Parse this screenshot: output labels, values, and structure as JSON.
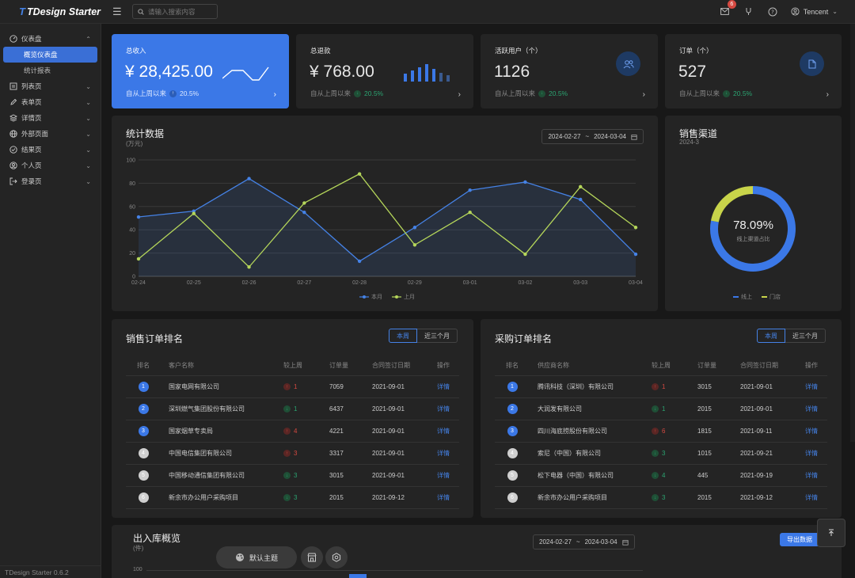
{
  "app": {
    "logo_mark": "T",
    "logo_text": "TDesign Starter",
    "version": "TDesign Starter 0.6.2"
  },
  "header": {
    "search_placeholder": "请输入搜索内容",
    "notice_count": "6",
    "user_name": "Tencent"
  },
  "sidebar": {
    "items": [
      {
        "label": "仪表盘",
        "icon": "dashboard-icon"
      },
      {
        "label": "列表页",
        "icon": "list-icon"
      },
      {
        "label": "表单页",
        "icon": "edit-icon"
      },
      {
        "label": "详情页",
        "icon": "layers-icon"
      },
      {
        "label": "外部页面",
        "icon": "globe-icon"
      },
      {
        "label": "结果页",
        "icon": "check-circle-icon"
      },
      {
        "label": "个人页",
        "icon": "user-circle-icon"
      },
      {
        "label": "登录页",
        "icon": "logout-icon"
      }
    ],
    "sub_items": [
      {
        "label": "概览仪表盘",
        "active": true
      },
      {
        "label": "统计报表",
        "active": false
      }
    ]
  },
  "stats": [
    {
      "title": "总收入",
      "value": "¥ 28,425.00",
      "foot": "自从上周以来",
      "delta": "20.5%",
      "trend": "down"
    },
    {
      "title": "总退款",
      "value": "¥ 768.00",
      "foot": "自从上周以来",
      "delta": "20.5%",
      "trend": "down"
    },
    {
      "title": "活跃用户（个）",
      "value": "1126",
      "foot": "自从上周以来",
      "delta": "20.5%",
      "trend": "down",
      "icon": "users-icon"
    },
    {
      "title": "订单（个）",
      "value": "527",
      "foot": "自从上周以来",
      "delta": "20.5%",
      "trend": "down",
      "icon": "file-icon"
    }
  ],
  "stats_chart": {
    "title": "统计数据",
    "subtitle": "(万元)",
    "date_start": "2024-02-27",
    "date_sep": "~",
    "date_end": "2024-03-04"
  },
  "chart_data": [
    {
      "type": "line",
      "title": "统计数据",
      "ylabel": "(万元)",
      "categories": [
        "02-24",
        "02-25",
        "02-26",
        "02-27",
        "02-28",
        "02-29",
        "03-01",
        "03-02",
        "03-03",
        "03-04"
      ],
      "ylim": [
        0,
        100
      ],
      "yticks": [
        0,
        20,
        40,
        60,
        80,
        100
      ],
      "grid": true,
      "legend": "bottom-center",
      "series": [
        {
          "name": "本月",
          "color": "#4582e6",
          "area": true,
          "values": [
            51,
            56,
            84,
            55,
            13,
            42,
            74,
            81,
            66,
            19
          ]
        },
        {
          "name": "上月",
          "color": "#b5d65a",
          "area": false,
          "values": [
            15,
            54,
            8,
            63,
            88,
            27,
            55,
            19,
            77,
            42
          ]
        }
      ]
    },
    {
      "type": "pie",
      "title": "销售渠道",
      "subtitle": "2024-3",
      "center_value": "78.09%",
      "center_label": "线上渠道占比",
      "legend": "bottom-center",
      "series": [
        {
          "name": "线上",
          "value": 78.09,
          "color": "#3b78e7"
        },
        {
          "name": "门店",
          "value": 21.91,
          "color": "#c8d44a"
        }
      ]
    }
  ],
  "sales_channel": {
    "title": "销售渠道",
    "subtitle": "2024-3",
    "center_value": "78.09%",
    "center_label": "线上渠道占比",
    "legend_online": "线上",
    "legend_store": "门店"
  },
  "sales_rank": {
    "title": "销售订单排名",
    "tab_week": "本周",
    "tab_quarter": "近三个月",
    "headers": [
      "排名",
      "客户名称",
      "较上周",
      "订单量",
      "合同签订日期",
      "操作"
    ],
    "rows": [
      {
        "rank": "1",
        "name": "国家电网有限公司",
        "delta": "1",
        "dir": "up",
        "count": "7059",
        "date": "2021-09-01",
        "op": "详情"
      },
      {
        "rank": "2",
        "name": "深圳燃气集团股份有限公司",
        "delta": "1",
        "dir": "down",
        "count": "6437",
        "date": "2021-09-01",
        "op": "详情"
      },
      {
        "rank": "3",
        "name": "国家烟草专卖局",
        "delta": "4",
        "dir": "up",
        "count": "4221",
        "date": "2021-09-01",
        "op": "详情"
      },
      {
        "rank": "4",
        "name": "中国电信集团有限公司",
        "delta": "3",
        "dir": "up",
        "count": "3317",
        "date": "2021-09-01",
        "op": "详情"
      },
      {
        "rank": "5",
        "name": "中国移动通信集团有限公司",
        "delta": "3",
        "dir": "down",
        "count": "3015",
        "date": "2021-09-01",
        "op": "详情"
      },
      {
        "rank": "6",
        "name": "新余市办公用户采购项目",
        "delta": "3",
        "dir": "down",
        "count": "2015",
        "date": "2021-09-12",
        "op": "详情"
      }
    ]
  },
  "purchase_rank": {
    "title": "采购订单排名",
    "tab_week": "本周",
    "tab_quarter": "近三个月",
    "headers": [
      "排名",
      "供应商名称",
      "较上周",
      "订单量",
      "合同签订日期",
      "操作"
    ],
    "rows": [
      {
        "rank": "1",
        "name": "腾讯科技（深圳）有限公司",
        "delta": "1",
        "dir": "up",
        "count": "3015",
        "date": "2021-09-01",
        "op": "详情"
      },
      {
        "rank": "2",
        "name": "大润发有限公司",
        "delta": "1",
        "dir": "down",
        "count": "2015",
        "date": "2021-09-01",
        "op": "详情"
      },
      {
        "rank": "3",
        "name": "四川海底捞股份有限公司",
        "delta": "6",
        "dir": "up",
        "count": "1815",
        "date": "2021-09-11",
        "op": "详情"
      },
      {
        "rank": "4",
        "name": "索尼（中国）有限公司",
        "delta": "3",
        "dir": "down",
        "count": "1015",
        "date": "2021-09-21",
        "op": "详情"
      },
      {
        "rank": "5",
        "name": "松下电器（中国）有限公司",
        "delta": "4",
        "dir": "down",
        "count": "445",
        "date": "2021-09-19",
        "op": "详情"
      },
      {
        "rank": "6",
        "name": "新余市办公用户采购项目",
        "delta": "3",
        "dir": "down",
        "count": "2015",
        "date": "2021-09-12",
        "op": "详情"
      }
    ]
  },
  "inout": {
    "title": "出入库概览",
    "subtitle": "(件)",
    "date_start": "2024-02-27",
    "date_sep": "~",
    "date_end": "2024-03-04",
    "export_label": "导出数据",
    "ytick_top": "100"
  },
  "floating": {
    "theme_label": "默认主题"
  }
}
